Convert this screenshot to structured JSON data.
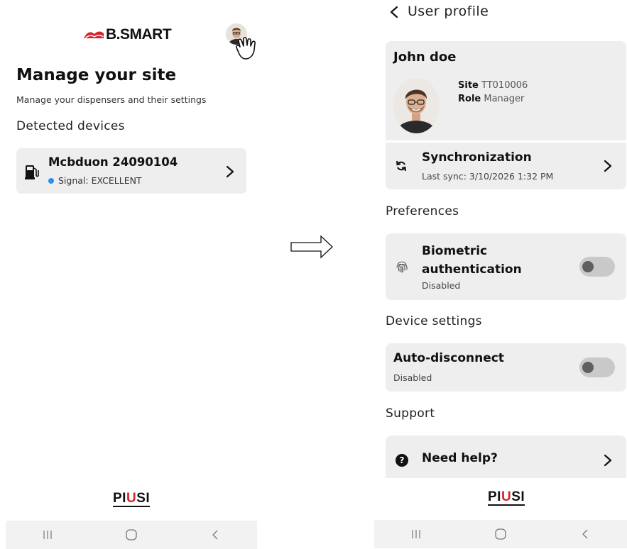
{
  "left_screen": {
    "logo_text": "B.SMART",
    "title": "Manage your site",
    "subtitle": "Manage your dispensers and their settings",
    "section_detected": "Detected devices",
    "device": {
      "name": "Mcbduon 24090104",
      "signal": "Signal: EXCELLENT",
      "signal_color": "#2f8df0"
    },
    "footer_brand": {
      "pre": "PI",
      "mid": "U",
      "post": "SI"
    }
  },
  "right_screen": {
    "header_title": "User profile",
    "user": {
      "name": "John doe",
      "site_label": "Site",
      "site_value": "TT010006",
      "role_label": "Role",
      "role_value": "Manager"
    },
    "sync": {
      "title": "Synchronization",
      "last_sync": "Last sync: 3/10/2026 1:32 PM"
    },
    "section_preferences": "Preferences",
    "biometric": {
      "title": "Biometric authentication",
      "status": "Disabled",
      "enabled": false
    },
    "section_device_settings": "Device settings",
    "auto_disconnect": {
      "title": "Auto-disconnect",
      "status": "Disabled",
      "enabled": false
    },
    "section_support": "Support",
    "help": {
      "title": "Need help?"
    },
    "footer_brand": {
      "pre": "PI",
      "mid": "U",
      "post": "SI"
    }
  },
  "icons": [
    "bsmart-logo",
    "avatar",
    "pointing-hand-icon",
    "fuel-pump-icon",
    "chevron-right-icon",
    "chevron-left-icon",
    "sync-icon",
    "fingerprint-icon",
    "question-icon",
    "arrow-right-icon",
    "recent-apps-icon",
    "home-icon",
    "back-icon"
  ],
  "colors": {
    "card_bg": "#eeeeee",
    "brand_red": "#d0262f",
    "toggle_off": "#c9c9c9"
  }
}
